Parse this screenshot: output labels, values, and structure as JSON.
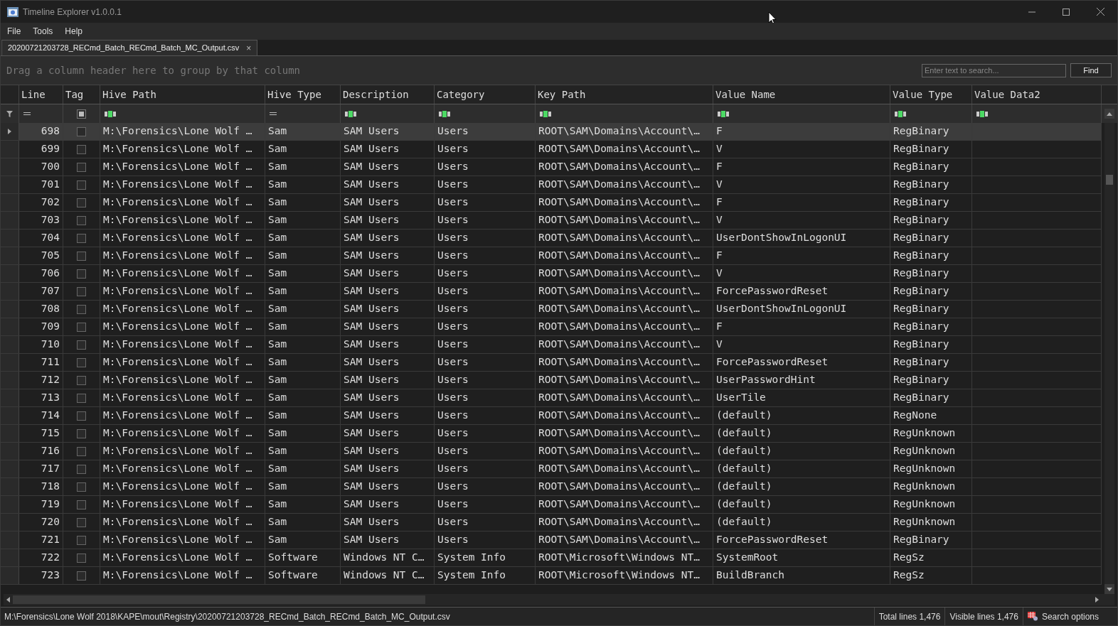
{
  "window": {
    "title": "Timeline Explorer v1.0.0.1"
  },
  "menu": [
    "File",
    "Tools",
    "Help"
  ],
  "tabs": [
    {
      "label": "20200721203728_RECmd_Batch_RECmd_Batch_MC_Output.csv",
      "close": "×",
      "selected": true
    }
  ],
  "group_panel": {
    "hint": "Drag a column header here to group by that column"
  },
  "search": {
    "placeholder": "Enter text to search...",
    "button": "Find"
  },
  "columns": [
    {
      "label": "Line",
      "kind": "equals"
    },
    {
      "label": "Tag",
      "kind": "checkbox"
    },
    {
      "label": "Hive Path",
      "kind": "text"
    },
    {
      "label": "Hive Type",
      "kind": "equals"
    },
    {
      "label": "Description",
      "kind": "text"
    },
    {
      "label": "Category",
      "kind": "text"
    },
    {
      "label": "Key Path",
      "kind": "text"
    },
    {
      "label": "Value Name",
      "kind": "text"
    },
    {
      "label": "Value Type",
      "kind": "text"
    },
    {
      "label": "Value Data2",
      "kind": "text"
    }
  ],
  "rows": [
    {
      "selected": true,
      "tagged": false,
      "cells": [
        "698",
        "M:\\Forensics\\Lone Wolf …",
        "Sam",
        "SAM Users",
        "Users",
        "ROOT\\SAM\\Domains\\Account\\…",
        "F",
        "RegBinary"
      ]
    },
    {
      "selected": false,
      "tagged": false,
      "cells": [
        "699",
        "M:\\Forensics\\Lone Wolf …",
        "Sam",
        "SAM Users",
        "Users",
        "ROOT\\SAM\\Domains\\Account\\…",
        "V",
        "RegBinary"
      ]
    },
    {
      "selected": false,
      "tagged": false,
      "cells": [
        "700",
        "M:\\Forensics\\Lone Wolf …",
        "Sam",
        "SAM Users",
        "Users",
        "ROOT\\SAM\\Domains\\Account\\…",
        "F",
        "RegBinary"
      ]
    },
    {
      "selected": false,
      "tagged": false,
      "cells": [
        "701",
        "M:\\Forensics\\Lone Wolf …",
        "Sam",
        "SAM Users",
        "Users",
        "ROOT\\SAM\\Domains\\Account\\…",
        "V",
        "RegBinary"
      ]
    },
    {
      "selected": false,
      "tagged": false,
      "cells": [
        "702",
        "M:\\Forensics\\Lone Wolf …",
        "Sam",
        "SAM Users",
        "Users",
        "ROOT\\SAM\\Domains\\Account\\…",
        "F",
        "RegBinary"
      ]
    },
    {
      "selected": false,
      "tagged": false,
      "cells": [
        "703",
        "M:\\Forensics\\Lone Wolf …",
        "Sam",
        "SAM Users",
        "Users",
        "ROOT\\SAM\\Domains\\Account\\…",
        "V",
        "RegBinary"
      ]
    },
    {
      "selected": false,
      "tagged": false,
      "cells": [
        "704",
        "M:\\Forensics\\Lone Wolf …",
        "Sam",
        "SAM Users",
        "Users",
        "ROOT\\SAM\\Domains\\Account\\…",
        "UserDontShowInLogonUI",
        "RegBinary"
      ]
    },
    {
      "selected": false,
      "tagged": false,
      "cells": [
        "705",
        "M:\\Forensics\\Lone Wolf …",
        "Sam",
        "SAM Users",
        "Users",
        "ROOT\\SAM\\Domains\\Account\\…",
        "F",
        "RegBinary"
      ]
    },
    {
      "selected": false,
      "tagged": false,
      "cells": [
        "706",
        "M:\\Forensics\\Lone Wolf …",
        "Sam",
        "SAM Users",
        "Users",
        "ROOT\\SAM\\Domains\\Account\\…",
        "V",
        "RegBinary"
      ]
    },
    {
      "selected": false,
      "tagged": false,
      "cells": [
        "707",
        "M:\\Forensics\\Lone Wolf …",
        "Sam",
        "SAM Users",
        "Users",
        "ROOT\\SAM\\Domains\\Account\\…",
        "ForcePasswordReset",
        "RegBinary"
      ]
    },
    {
      "selected": false,
      "tagged": false,
      "cells": [
        "708",
        "M:\\Forensics\\Lone Wolf …",
        "Sam",
        "SAM Users",
        "Users",
        "ROOT\\SAM\\Domains\\Account\\…",
        "UserDontShowInLogonUI",
        "RegBinary"
      ]
    },
    {
      "selected": false,
      "tagged": false,
      "cells": [
        "709",
        "M:\\Forensics\\Lone Wolf …",
        "Sam",
        "SAM Users",
        "Users",
        "ROOT\\SAM\\Domains\\Account\\…",
        "F",
        "RegBinary"
      ]
    },
    {
      "selected": false,
      "tagged": false,
      "cells": [
        "710",
        "M:\\Forensics\\Lone Wolf …",
        "Sam",
        "SAM Users",
        "Users",
        "ROOT\\SAM\\Domains\\Account\\…",
        "V",
        "RegBinary"
      ]
    },
    {
      "selected": false,
      "tagged": false,
      "cells": [
        "711",
        "M:\\Forensics\\Lone Wolf …",
        "Sam",
        "SAM Users",
        "Users",
        "ROOT\\SAM\\Domains\\Account\\…",
        "ForcePasswordReset",
        "RegBinary"
      ]
    },
    {
      "selected": false,
      "tagged": false,
      "cells": [
        "712",
        "M:\\Forensics\\Lone Wolf …",
        "Sam",
        "SAM Users",
        "Users",
        "ROOT\\SAM\\Domains\\Account\\…",
        "UserPasswordHint",
        "RegBinary"
      ]
    },
    {
      "selected": false,
      "tagged": false,
      "cells": [
        "713",
        "M:\\Forensics\\Lone Wolf …",
        "Sam",
        "SAM Users",
        "Users",
        "ROOT\\SAM\\Domains\\Account\\…",
        "UserTile",
        "RegBinary"
      ]
    },
    {
      "selected": false,
      "tagged": false,
      "cells": [
        "714",
        "M:\\Forensics\\Lone Wolf …",
        "Sam",
        "SAM Users",
        "Users",
        "ROOT\\SAM\\Domains\\Account\\…",
        "(default)",
        "RegNone"
      ]
    },
    {
      "selected": false,
      "tagged": false,
      "cells": [
        "715",
        "M:\\Forensics\\Lone Wolf …",
        "Sam",
        "SAM Users",
        "Users",
        "ROOT\\SAM\\Domains\\Account\\…",
        "(default)",
        "RegUnknown"
      ]
    },
    {
      "selected": false,
      "tagged": false,
      "cells": [
        "716",
        "M:\\Forensics\\Lone Wolf …",
        "Sam",
        "SAM Users",
        "Users",
        "ROOT\\SAM\\Domains\\Account\\…",
        "(default)",
        "RegUnknown"
      ]
    },
    {
      "selected": false,
      "tagged": false,
      "cells": [
        "717",
        "M:\\Forensics\\Lone Wolf …",
        "Sam",
        "SAM Users",
        "Users",
        "ROOT\\SAM\\Domains\\Account\\…",
        "(default)",
        "RegUnknown"
      ]
    },
    {
      "selected": false,
      "tagged": false,
      "cells": [
        "718",
        "M:\\Forensics\\Lone Wolf …",
        "Sam",
        "SAM Users",
        "Users",
        "ROOT\\SAM\\Domains\\Account\\…",
        "(default)",
        "RegUnknown"
      ]
    },
    {
      "selected": false,
      "tagged": false,
      "cells": [
        "719",
        "M:\\Forensics\\Lone Wolf …",
        "Sam",
        "SAM Users",
        "Users",
        "ROOT\\SAM\\Domains\\Account\\…",
        "(default)",
        "RegUnknown"
      ]
    },
    {
      "selected": false,
      "tagged": false,
      "cells": [
        "720",
        "M:\\Forensics\\Lone Wolf …",
        "Sam",
        "SAM Users",
        "Users",
        "ROOT\\SAM\\Domains\\Account\\…",
        "(default)",
        "RegUnknown"
      ]
    },
    {
      "selected": false,
      "tagged": false,
      "cells": [
        "721",
        "M:\\Forensics\\Lone Wolf …",
        "Sam",
        "SAM Users",
        "Users",
        "ROOT\\SAM\\Domains\\Account\\…",
        "ForcePasswordReset",
        "RegBinary"
      ]
    },
    {
      "selected": false,
      "tagged": false,
      "cells": [
        "722",
        "M:\\Forensics\\Lone Wolf …",
        "Software",
        "Windows NT C…",
        "System Info",
        "ROOT\\Microsoft\\Windows NT…",
        "SystemRoot",
        "RegSz"
      ]
    },
    {
      "selected": false,
      "tagged": false,
      "cells": [
        "723",
        "M:\\Forensics\\Lone Wolf …",
        "Software",
        "Windows NT C…",
        "System Info",
        "ROOT\\Microsoft\\Windows NT…",
        "BuildBranch",
        "RegSz"
      ]
    }
  ],
  "status_bar": {
    "path": "M:\\Forensics\\Lone Wolf 2018\\KAPE\\mout\\Registry\\20200721203728_RECmd_Batch_RECmd_Batch_MC_Output.csv",
    "total": "Total lines 1,476",
    "visible": "Visible lines 1,476",
    "options": "Search options"
  }
}
